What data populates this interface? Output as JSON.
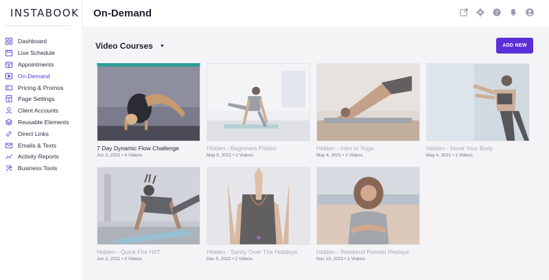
{
  "app": {
    "logo": "INSTABOOK"
  },
  "header": {
    "title": "On-Demand"
  },
  "sidebar": {
    "items": [
      {
        "label": "Dashboard",
        "icon": "grid-icon"
      },
      {
        "label": "Live Schedule",
        "icon": "calendar-icon"
      },
      {
        "label": "Appointments",
        "icon": "appointment-icon"
      },
      {
        "label": "On-Demand",
        "icon": "play-icon",
        "active": true
      },
      {
        "label": "Pricing & Promos",
        "icon": "ticket-icon"
      },
      {
        "label": "Page Settings",
        "icon": "page-icon"
      },
      {
        "label": "Client Accounts",
        "icon": "users-icon"
      },
      {
        "label": "Reusable Elements",
        "icon": "layers-icon"
      },
      {
        "label": "Direct Links",
        "icon": "link-icon"
      },
      {
        "label": "Emails & Texts",
        "icon": "mail-icon"
      },
      {
        "label": "Activity Reports",
        "icon": "chart-icon"
      },
      {
        "label": "Business Tools",
        "icon": "tools-icon"
      }
    ]
  },
  "main": {
    "section_title": "Video Courses",
    "add_button": "ADD NEW",
    "courses": [
      {
        "title": "7 Day Dynamic Flow Challenge",
        "meta": "Jun 3, 2021 • 4 Videos",
        "hidden": false
      },
      {
        "title": "Hidden - Beginners Pilates",
        "meta": "May 5, 2021 • 2 Videos",
        "hidden": true
      },
      {
        "title": "Hidden - Intro to Yoga",
        "meta": "May 4, 2021 • 2 Videos",
        "hidden": true
      },
      {
        "title": "Hidden - Move Your Body",
        "meta": "May 4, 2021 • 1 Videos",
        "hidden": true
      },
      {
        "title": "Hidden - Quick Fire HIIT",
        "meta": "Jun 3, 2021 • 2 Videos",
        "hidden": true
      },
      {
        "title": "Hidden - Sanity Over The Holidays",
        "meta": "Dec 5, 2022 • 2 Videos",
        "hidden": true
      },
      {
        "title": "Hidden - Weekend Retreat Replays",
        "meta": "Nov 13, 2023 • 1 Videos",
        "hidden": true
      }
    ]
  },
  "colors": {
    "accent": "#5b2fd9",
    "active_nav": "#5b37d6",
    "hidden_text": "#a6a8bb"
  }
}
